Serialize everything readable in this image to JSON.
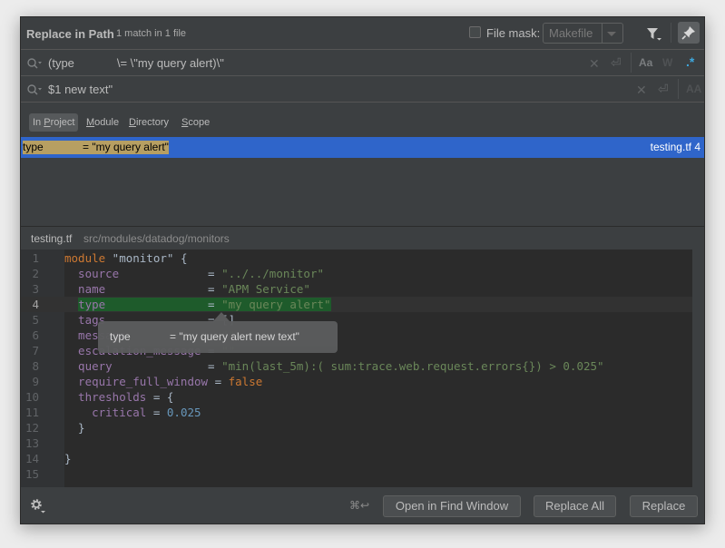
{
  "dialog": {
    "title": "Replace in Path",
    "subtitle": "1 match in 1 file",
    "file_mask_label": "File mask:",
    "file_mask_checked": false,
    "file_mask_value": "Makefile"
  },
  "search": {
    "find_value": "(type             \\= \\\"my query alert)\\\"",
    "replace_value": "$1 new text\"",
    "find_options": [
      "Aa",
      "W",
      ".*"
    ],
    "replace_options": [
      "AA"
    ]
  },
  "scopes": [
    {
      "label_pre": "In ",
      "mnemonic": "P",
      "label_post": "roject",
      "active": true
    },
    {
      "label_pre": "",
      "mnemonic": "M",
      "label_post": "odule",
      "active": false
    },
    {
      "label_pre": "",
      "mnemonic": "D",
      "label_post": "irectory",
      "active": false
    },
    {
      "label_pre": "",
      "mnemonic": "S",
      "label_post": "cope",
      "active": false
    }
  ],
  "results": [
    {
      "text": "type             = \"my query alert\"",
      "file": "testing.tf 4"
    }
  ],
  "preview": {
    "file": "testing.tf",
    "path": "src/modules/datadog/monitors",
    "current_line": 4
  },
  "code_lines": [
    {
      "n": "1"
    },
    {
      "n": "2"
    },
    {
      "n": "3"
    },
    {
      "n": "4"
    },
    {
      "n": "5"
    },
    {
      "n": "6"
    },
    {
      "n": "7"
    },
    {
      "n": "8"
    },
    {
      "n": "9"
    },
    {
      "n": "10"
    },
    {
      "n": "11"
    },
    {
      "n": "12"
    },
    {
      "n": "13"
    },
    {
      "n": "14"
    },
    {
      "n": "15"
    }
  ],
  "code": {
    "l1_kw": "module",
    "l1_rest": " \"monitor\" {",
    "l2_attr": "  source",
    "l2_eq": "             = ",
    "l2_str": "\"../../monitor\"",
    "l3_attr": "  name",
    "l3_eq": "               = ",
    "l3_str": "\"APM Service\"",
    "l4_attr": "type",
    "l4_eq": "               = ",
    "l4_str": "\"my query alert\"",
    "l5_attr": "  tags",
    "l5_eq": "               = ",
    "l5_rest": "[]",
    "l6_attr": "  message",
    "l6_eq": "            = ",
    "l6_str": "\"\"",
    "l7_attr": "  escalation_message",
    "l7_eq": " = ",
    "l7_str": "\"\"",
    "l8_attr": "  query",
    "l8_eq": "              = ",
    "l8_str": "\"min(last_5m):( sum:trace.web.request.errors{}) > 0.025\"",
    "l9_attr": "  require_full_window",
    "l9_eq": " = ",
    "l9_kw": "false",
    "l10_attr": "  thresholds",
    "l10_rest": " = {",
    "l11_attr": "    critical",
    "l11_eq": " = ",
    "l11_num": "0.025",
    "l12": "  }",
    "l13": "",
    "l14": "}",
    "l15": ""
  },
  "tooltip": {
    "text": "type             = \"my query alert new text\""
  },
  "footer": {
    "shortcut": "⌘↩",
    "open_in_find_window": "Open in Find Window",
    "replace_all": "Replace All",
    "replace": "Replace"
  },
  "colors": {
    "selection": "#2f65ca",
    "match_highlight": "#b79f62",
    "line_highlight": "#1e5b2b",
    "regex_active": "#3ea8de"
  }
}
